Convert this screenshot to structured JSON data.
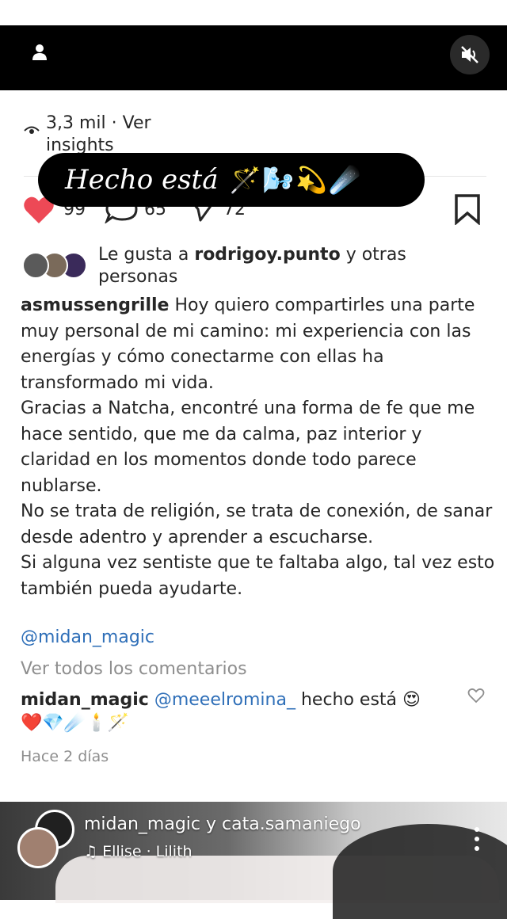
{
  "views": {
    "count_text": "3,3 mil · Ver",
    "insights_text": "insights"
  },
  "caption_pill": {
    "text": "Hecho está",
    "emoji": "🪄🌬️💫☄️"
  },
  "actions": {
    "likes": "99",
    "comments": "65",
    "shares": "72"
  },
  "likes": {
    "prefix": "Le gusta a ",
    "user": "rodrigoy.punto",
    "suffix": " y otras personas"
  },
  "post": {
    "username": "asmussengrille",
    "para1": "Hoy quiero compartirles una parte muy personal de mi camino: mi experiencia con las energías y cómo conectarme con ellas ha transformado mi vida.",
    "para2": "Gracias a Natcha, encontré una forma de fe que me hace sentido, que me da calma, paz interior y claridad en los momentos donde todo parece nublarse.",
    "para3": "No se trata de religión, se trata de conexión, de sanar desde adentro y aprender a escucharse.",
    "para4": "Si alguna vez sentiste que te faltaba algo, tal vez esto también pueda ayudarte.",
    "mention": "@midan_magic"
  },
  "comments": {
    "view_all": "Ver todos los comentarios",
    "top": {
      "user": "midan_magic",
      "mention": "@meeelromina_",
      "text": " hecho está 😍",
      "emojis": "❤️💎☄️🕯️🪄"
    },
    "timestamp": "Hace 2 días"
  },
  "next_reel": {
    "users": "midan_magic y cata.samaniego",
    "music": "Ellise · Lilith"
  },
  "colors": {
    "link": "#2f6fb8",
    "heart": "#ed4956",
    "muted_text": "#8e8e8e"
  }
}
